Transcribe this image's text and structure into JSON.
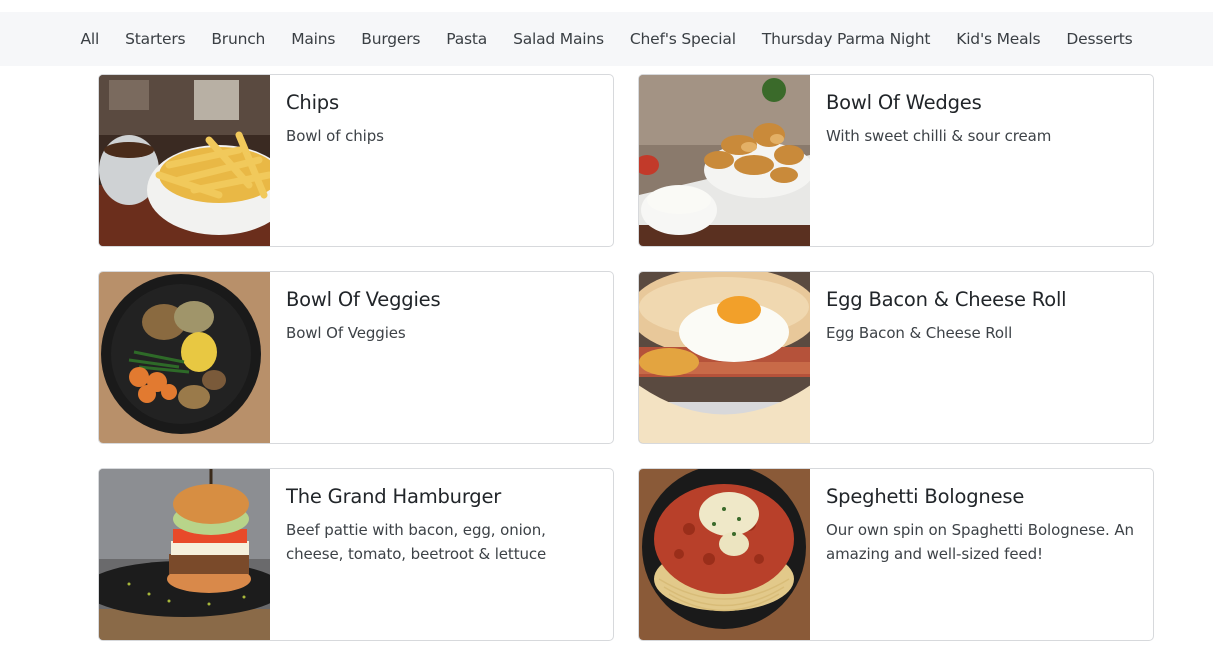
{
  "nav": {
    "categories": [
      "All",
      "Starters",
      "Brunch",
      "Mains",
      "Burgers",
      "Pasta",
      "Salad Mains",
      "Chef's Special",
      "Thursday Parma Night",
      "Kid's Meals",
      "Desserts"
    ]
  },
  "menu": {
    "items": [
      {
        "title": "Chips",
        "description": "Bowl of chips",
        "image_icon": "chips-photo"
      },
      {
        "title": "Bowl Of Wedges",
        "description": "With sweet chilli & sour cream",
        "image_icon": "wedges-photo"
      },
      {
        "title": "Bowl Of Veggies",
        "description": "Bowl Of Veggies",
        "image_icon": "veggies-photo"
      },
      {
        "title": "Egg Bacon & Cheese Roll",
        "description": "Egg Bacon & Cheese Roll",
        "image_icon": "egg-roll-photo"
      },
      {
        "title": "The Grand Hamburger",
        "description": "Beef pattie with bacon, egg, onion, cheese, tomato, beetroot & lettuce",
        "image_icon": "hamburger-photo"
      },
      {
        "title": "Speghetti Bolognese",
        "description": "Our own spin on Spaghetti Bolognese. An amazing and well-sized feed!",
        "image_icon": "spaghetti-photo"
      }
    ]
  }
}
